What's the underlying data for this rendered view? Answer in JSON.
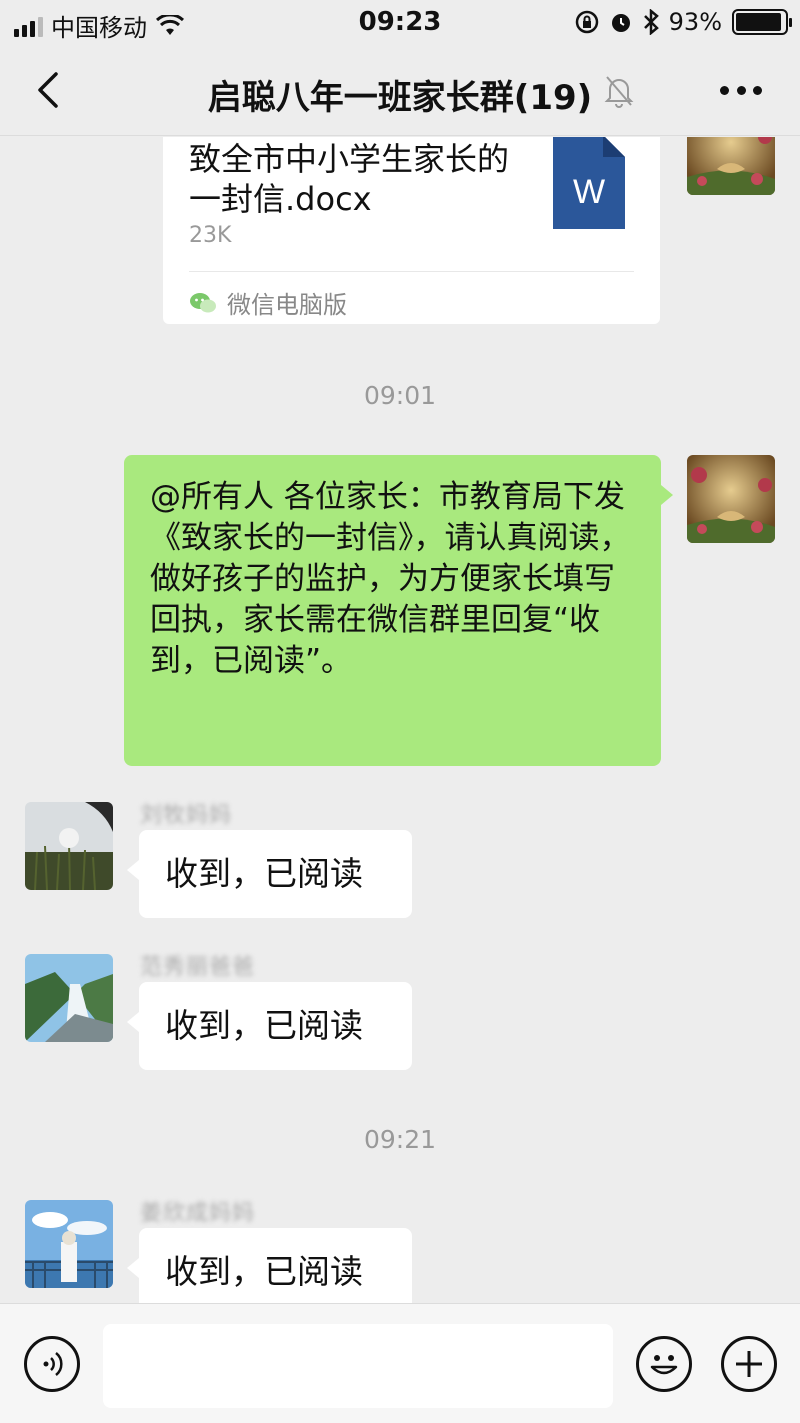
{
  "status_bar": {
    "carrier": "中国移动",
    "time": "09:23",
    "battery": "93%",
    "battery_level": 0.93,
    "icons": [
      "signal-icon",
      "wifi-icon",
      "rotation-lock-icon",
      "alarm-icon",
      "bluetooth-icon",
      "battery-icon"
    ]
  },
  "nav": {
    "title": "启聪八年一班家长群(19)",
    "icons": [
      "back-icon",
      "mute-bell-icon",
      "more-icon"
    ]
  },
  "file_message": {
    "file_name": "致全市中小学生家长的一封信.docx",
    "file_size": "23K",
    "source": "微信电脑版",
    "icons": [
      "word-doc-icon",
      "wechat-icon"
    ]
  },
  "timestamps": [
    "09:01",
    "09:21"
  ],
  "announcement": {
    "text": "@所有人 各位家长：市教育局下发《致家长的一封信》，请认真阅读，做好孩子的监护，为方便家长填写回执，家长需在微信群里回复“收到，已阅读”。"
  },
  "replies": [
    {
      "sender": "刘牧妈妈",
      "text": "收到，已阅读"
    },
    {
      "sender": "范秀丽爸爸",
      "text": "收到，已阅读"
    },
    {
      "sender": "姜欣成妈妈",
      "text": "收到，已阅读"
    }
  ],
  "input_bar": {
    "placeholder": "",
    "icons": [
      "voice-icon",
      "emoji-icon",
      "plus-icon"
    ]
  }
}
